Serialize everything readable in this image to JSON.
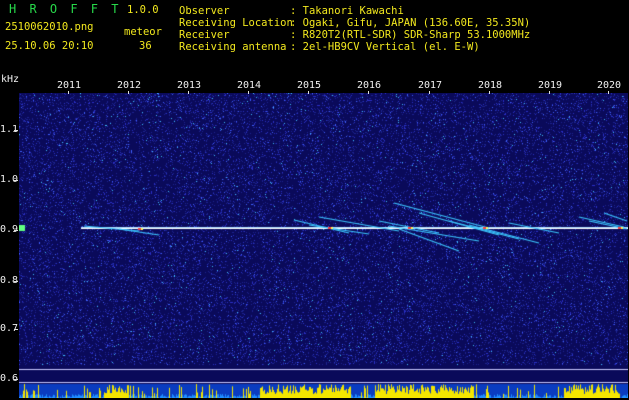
{
  "header": {
    "app_name": "H R O F F T",
    "version": "1.0.0",
    "filename": "2510062010.png",
    "event_label": "meteor",
    "timestamp": "25.10.06 20:10",
    "count": "36",
    "info_labels": [
      "Observer",
      "Receiving Location",
      "Receiver",
      "Receiving antenna"
    ],
    "info_values": [
      ": Takanori Kawachi",
      ": Ogaki, Gifu, JAPAN (136.60E, 35.35N)",
      ": R820T2(RTL-SDR) SDR-Sharp 53.1000MHz",
      ": 2el-HB9CV Vertical (el. E-W)"
    ]
  },
  "spectrogram": {
    "y_unit": "kHz",
    "y_ticks": [
      "1.1",
      "1.0",
      "0.9",
      "0.8",
      "0.7",
      "0.6"
    ],
    "x_ticks": [
      "2011",
      "2012",
      "2013",
      "2014",
      "2015",
      "2016",
      "2017",
      "2018",
      "2019",
      "2020"
    ],
    "carrier_frequency_khz": 0.905,
    "colors": {
      "background": "#0a0a5a",
      "noise": "#2a30c8",
      "carrier": "#ffffff",
      "trace": "#3cc8ff",
      "signal_bar": "#f4e600",
      "text_green": "#27d84a",
      "text_yellow": "#f2e81e"
    }
  }
}
